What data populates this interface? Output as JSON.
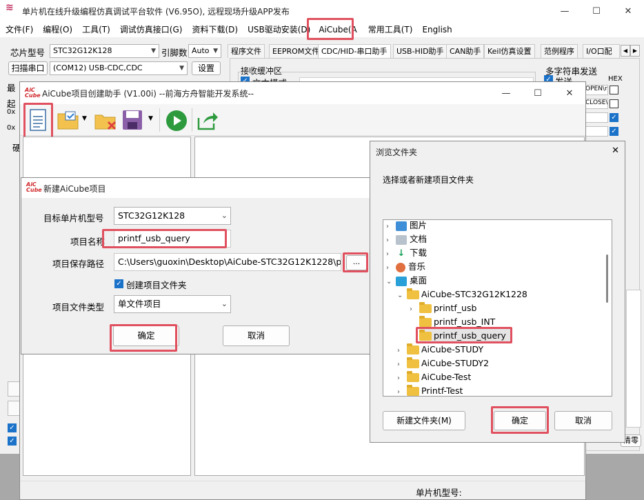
{
  "main": {
    "title": "单片机在线升级编程仿真调试平台软件 (V6.95O), 远程现场升级APP发布",
    "menu": [
      "文件(F)",
      "编程(O)",
      "工具(T)",
      "调试仿真接口(G)",
      "资料下载(D)",
      "USB驱动安装(D)",
      "AiCube(A",
      "常用工具(T)",
      "English"
    ],
    "chip_label": "芯片型号",
    "chip_value": "STC32G12K128",
    "pin_label": "引脚数",
    "pin_value": "Auto",
    "scan_label": "扫描串口",
    "port_value": "(COM12) USB-CDC,CDC",
    "settings_btn": "设置",
    "tabs": [
      "程序文件",
      "EEPROM文件",
      "CDC/HID-串口助手",
      "USB-HID助手",
      "CAN助手",
      "Keil仿真设置",
      "范例程序",
      "I/O口配"
    ],
    "recv_label": "接收缓冲区",
    "text_mode": "文本模式",
    "multi_label": "多字符串发送",
    "send_label": "发送",
    "hex_label": "HEX",
    "frag_open": "OPEN\\r",
    "frag_close": "CLOSE\\",
    "chip_model_label": "单片机型号:",
    "clear_frag": "清零",
    "left_frags": [
      "最",
      "起",
      "0x",
      "0x",
      "硬"
    ]
  },
  "helper": {
    "title": "AiCube项目创建助手 (V1.00i) --前海方舟智能开发系统--"
  },
  "newproj": {
    "title": "新建AiCube项目",
    "target_label": "目标单片机型号",
    "target_value": "STC32G12K128",
    "name_label": "项目名称",
    "name_value": "printf_usb_query",
    "path_label": "项目保存路径",
    "path_value": "C:\\Users\\guoxin\\Desktop\\AiCube-STC32G12K1228\\p",
    "browse_btn": "...",
    "create_folder": "创建项目文件夹",
    "type_label": "项目文件类型",
    "type_value": "单文件项目",
    "ok_btn": "确定",
    "cancel_btn": "取消"
  },
  "browse": {
    "title": "浏览文件夹",
    "prompt": "选择或者新建项目文件夹",
    "tree": [
      "图片",
      "文档",
      "下载",
      "音乐",
      "桌面",
      "AiCube-STC32G12K1228",
      "printf_usb",
      "printf_usb_INT",
      "printf_usb_query",
      "AiCube-STUDY",
      "AiCube-STUDY2",
      "AiCube-Test",
      "Printf-Test"
    ],
    "new_folder_btn": "新建文件夹(M)",
    "ok_btn": "确定",
    "cancel_btn": "取消"
  },
  "colors": {
    "highlight": "#e0505e",
    "accent": "#1b72c9"
  }
}
